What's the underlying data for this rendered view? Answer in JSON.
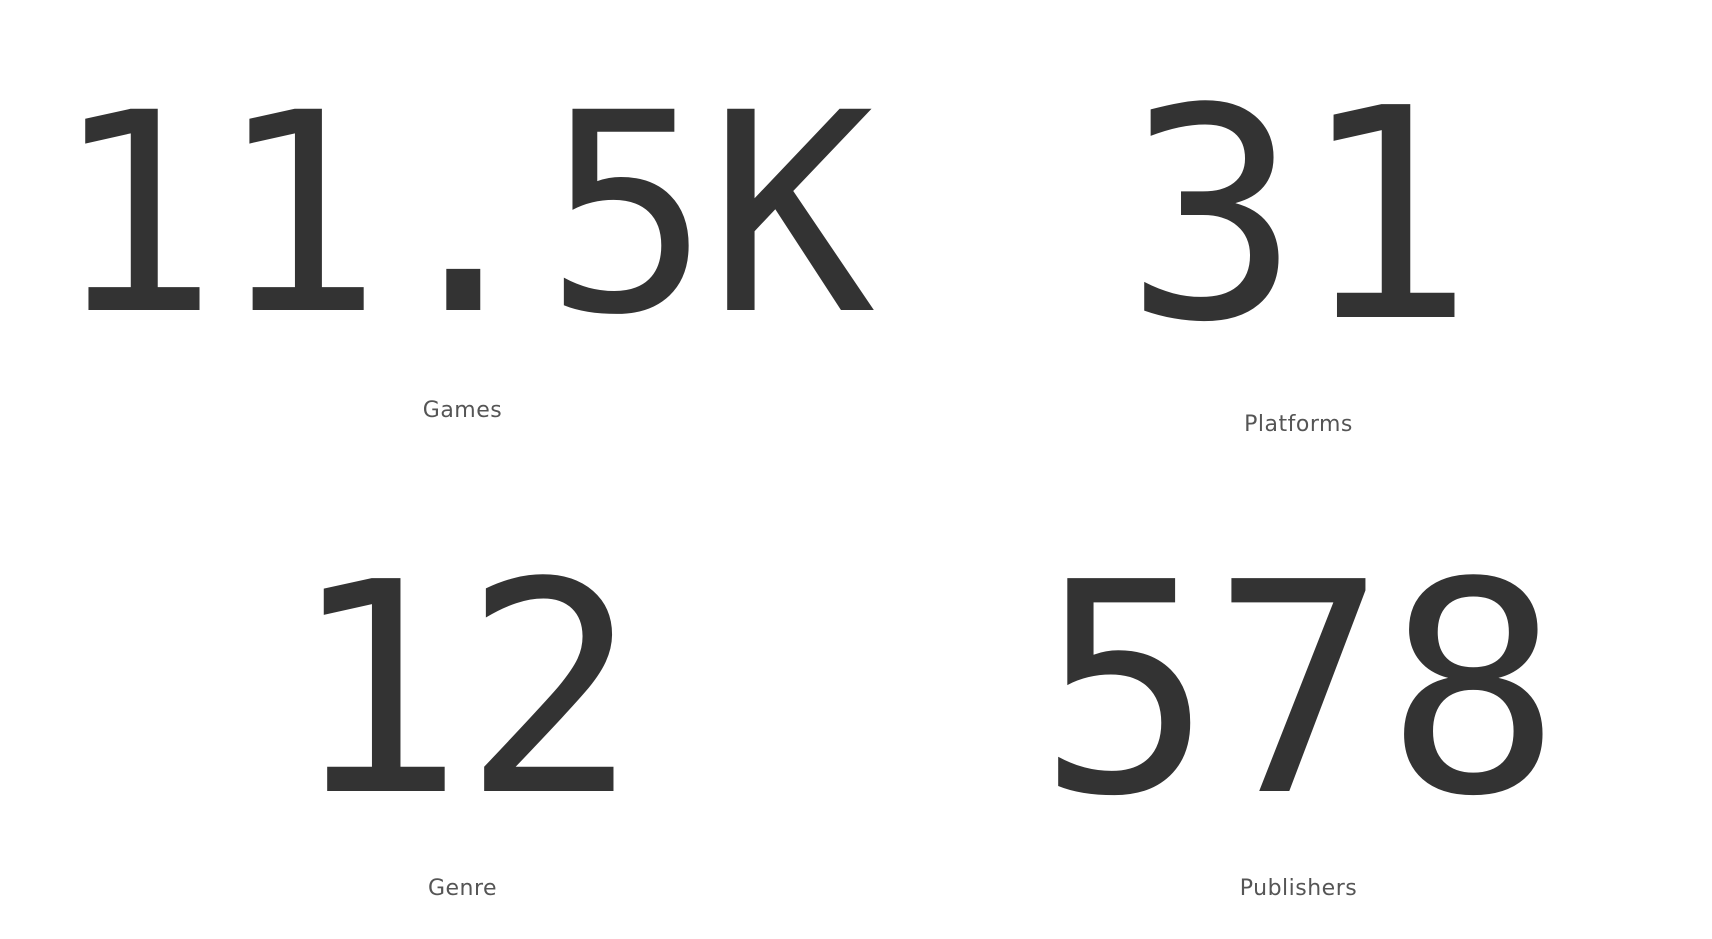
{
  "kpis": {
    "games": {
      "value": "11.5K",
      "label": "Games"
    },
    "platforms": {
      "value": "31",
      "label": "Platforms"
    },
    "genre": {
      "value": "12",
      "label": "Genre"
    },
    "publishers": {
      "value": "578",
      "label": "Publishers"
    }
  },
  "colors": {
    "background": "#ffffff",
    "value_text": "#333333",
    "label_text": "#555555"
  }
}
